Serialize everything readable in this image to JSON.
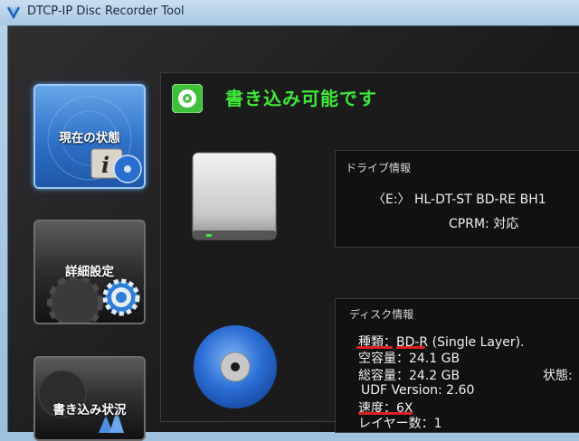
{
  "window": {
    "title": "DTCP-IP Disc Recorder Tool"
  },
  "sidebar": {
    "items": [
      {
        "label": "現在の状態",
        "state": "active"
      },
      {
        "label": "詳細設定",
        "state": "normal"
      },
      {
        "label": "書き込み状況",
        "state": "normal"
      }
    ]
  },
  "status": {
    "text": "書き込み可能です",
    "color": "#3fe83a"
  },
  "drive": {
    "title": "ドライブ情報",
    "name": "〈E:〉 HL-DT-ST BD-RE  BH1",
    "cprm": "CPRM:  対応"
  },
  "disc": {
    "title": "ディスク情報",
    "type": "種類：BD-R (Single Layer).",
    "free": "空容量：24.1 GB",
    "total": "総容量：24.2 GB",
    "state_label": "状態:",
    "udf": "UDF Version: 2.60",
    "speed": "速度：6X",
    "layers": "レイヤー数：1"
  },
  "colors": {
    "accent": "#2f71c8",
    "status_green": "#3fe83a",
    "annotation_red": "#e02020"
  }
}
